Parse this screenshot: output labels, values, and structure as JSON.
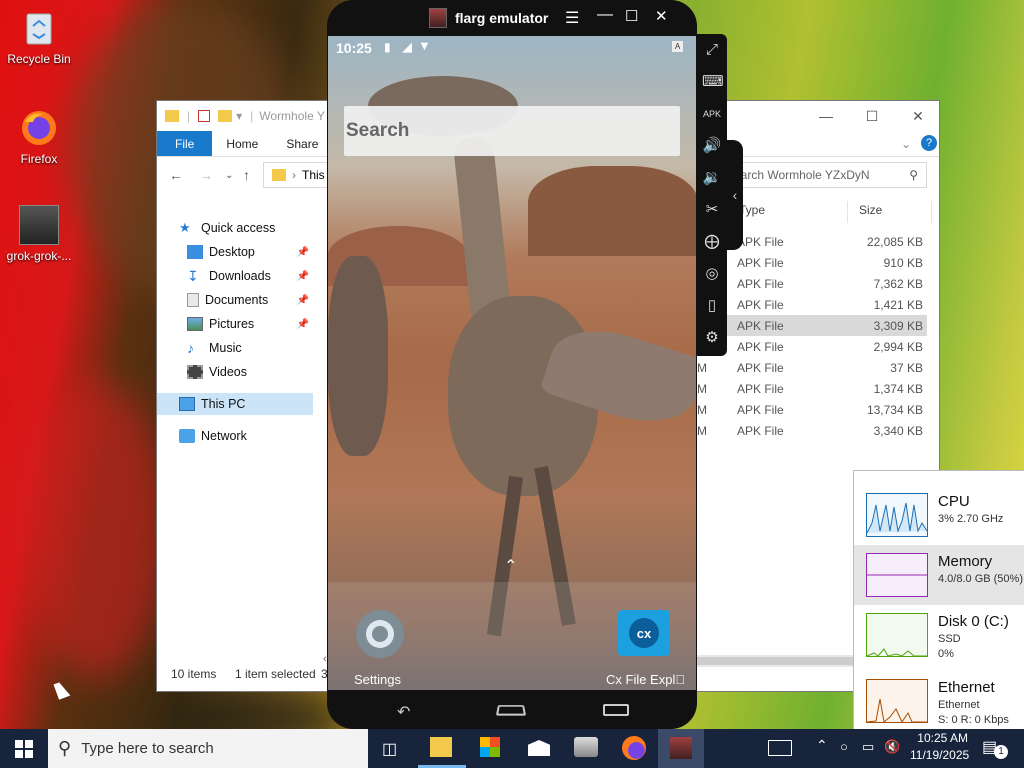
{
  "desktop": {
    "icons": [
      {
        "label": "Recycle Bin"
      },
      {
        "label": "Firefox"
      },
      {
        "label": "grok-grok-..."
      }
    ]
  },
  "explorer": {
    "title": "Wormhole Y",
    "ribbon_tabs": [
      "File",
      "Home",
      "Share"
    ],
    "address_text": "This",
    "search_placeholder": "earch Wormhole YZxDyN",
    "columns": {
      "type": "Type",
      "size": "Size"
    },
    "nav": {
      "quick_access": "Quick access",
      "desktop": "Desktop",
      "downloads": "Downloads",
      "documents": "Documents",
      "pictures": "Pictures",
      "music": "Music",
      "videos": "Videos",
      "this_pc": "This PC",
      "network": "Network"
    },
    "files": [
      {
        "m": "",
        "type": "APK File",
        "size": "22,085 KB"
      },
      {
        "m": "",
        "type": "APK File",
        "size": "910 KB"
      },
      {
        "m": "",
        "type": "APK File",
        "size": "7,362 KB"
      },
      {
        "m": "",
        "type": "APK File",
        "size": "1,421 KB"
      },
      {
        "m": "",
        "type": "APK File",
        "size": "3,309 KB"
      },
      {
        "m": "",
        "type": "APK File",
        "size": "2,994 KB"
      },
      {
        "m": "M",
        "type": "APK File",
        "size": "37 KB"
      },
      {
        "m": "M",
        "type": "APK File",
        "size": "1,374 KB"
      },
      {
        "m": "M",
        "type": "APK File",
        "size": "13,734 KB"
      },
      {
        "m": "M",
        "type": "APK File",
        "size": "3,340 KB"
      }
    ],
    "status": {
      "count": "10 items",
      "selected": "1 item selected",
      "extra": "3"
    }
  },
  "emulator": {
    "title": "flarg emulator",
    "status_time": "10:25",
    "search_placeholder": "Search",
    "apps": [
      {
        "label": "Settings"
      },
      {
        "label": "Cx File Expl⃢"
      }
    ]
  },
  "perf": {
    "cpu": {
      "title": "CPU",
      "sub": "3% 2.70 GHz"
    },
    "memory": {
      "title": "Memory",
      "sub": "4.0/8.0 GB (50%)"
    },
    "disk": {
      "title": "Disk 0 (C:)",
      "sub1": "SSD",
      "sub2": "0%"
    },
    "ethernet": {
      "title": "Ethernet",
      "sub1": "Ethernet",
      "sub2": "S: 0 R: 0 Kbps"
    }
  },
  "taskbar": {
    "search_placeholder": "Type here to search",
    "time": "10:25 AM",
    "date": "11/19/2025",
    "notif_count": "1"
  },
  "colors": {
    "accent": "#1979ca",
    "taskbar": "#17243b"
  }
}
